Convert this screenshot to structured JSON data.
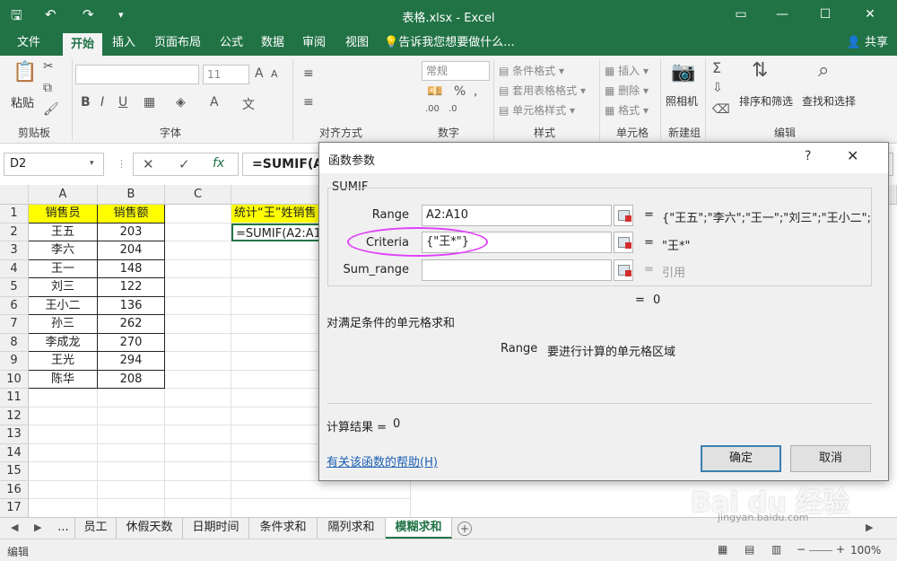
{
  "window": {
    "title": "表格.xlsx - Excel"
  },
  "ribbon_tabs": [
    "文件",
    "开始",
    "插入",
    "页面布局",
    "公式",
    "数据",
    "审阅",
    "视图"
  ],
  "tell_me": "告诉我您想要做什么...",
  "share": "共享",
  "ribbon": {
    "paste": "粘贴",
    "clipboard": "剪贴板",
    "font_size": "11",
    "font_group": "字体",
    "align_group": "对齐方式",
    "number_format": "常规",
    "number_group": "数字",
    "cond_format": "条件格式",
    "table_format": "套用表格格式",
    "cell_style": "单元格样式",
    "style_group": "样式",
    "insert": "插入",
    "delete": "删除",
    "format": "格式",
    "cells_group": "单元格",
    "camera": "照相机",
    "new_group": "新建组",
    "sort_filter": "排序和筛选",
    "find_select": "查找和选择",
    "edit_group": "编辑"
  },
  "name_box": "D2",
  "formula": "=SUMIF(A2:A",
  "columns": [
    "A",
    "B",
    "C"
  ],
  "rows": [
    "1",
    "2",
    "3",
    "4",
    "5",
    "6",
    "7",
    "8",
    "9",
    "10",
    "11",
    "12",
    "13",
    "14",
    "15",
    "16",
    "17"
  ],
  "table": {
    "headers": [
      "销售员",
      "销售额"
    ],
    "data": [
      [
        "王五",
        "203"
      ],
      [
        "李六",
        "204"
      ],
      [
        "王一",
        "148"
      ],
      [
        "刘三",
        "122"
      ],
      [
        "王小二",
        "136"
      ],
      [
        "孙三",
        "262"
      ],
      [
        "李成龙",
        "270"
      ],
      [
        "王光",
        "294"
      ],
      [
        "陈华",
        "208"
      ]
    ]
  },
  "d1_text": "统计“王”姓销售",
  "d2_text": "=SUMIF(A2:A1",
  "sheet_tabs": [
    "...",
    "员工",
    "休假天数",
    "日期时间",
    "条件求和",
    "隔列求和",
    "模糊求和"
  ],
  "status": {
    "mode": "编辑",
    "zoom": "100%"
  },
  "dialog": {
    "title": "函数参数",
    "help": "?",
    "close": "✕",
    "function_name": "SUMIF",
    "args": [
      {
        "label": "Range",
        "value": "A2:A10",
        "result": "{\"王五\";\"李六\";\"王一\";\"刘三\";\"王小二\";\"..."
      },
      {
        "label": "Criteria",
        "value": "{\"王*\"}",
        "result": "\"王*\""
      },
      {
        "label": "Sum_range",
        "value": "",
        "result": "引用"
      }
    ],
    "eq_result": "0",
    "description": "对满足条件的单元格求和",
    "arg_help_name": "Range",
    "arg_help_text": "要进行计算的单元格区域",
    "calc_label": "计算结果 =",
    "calc_value": "0",
    "help_link": "有关该函数的帮助(H)",
    "ok": "确定",
    "cancel": "取消"
  },
  "watermark": "Bai du 经验",
  "watermark_url": "jingyan.baidu.com"
}
